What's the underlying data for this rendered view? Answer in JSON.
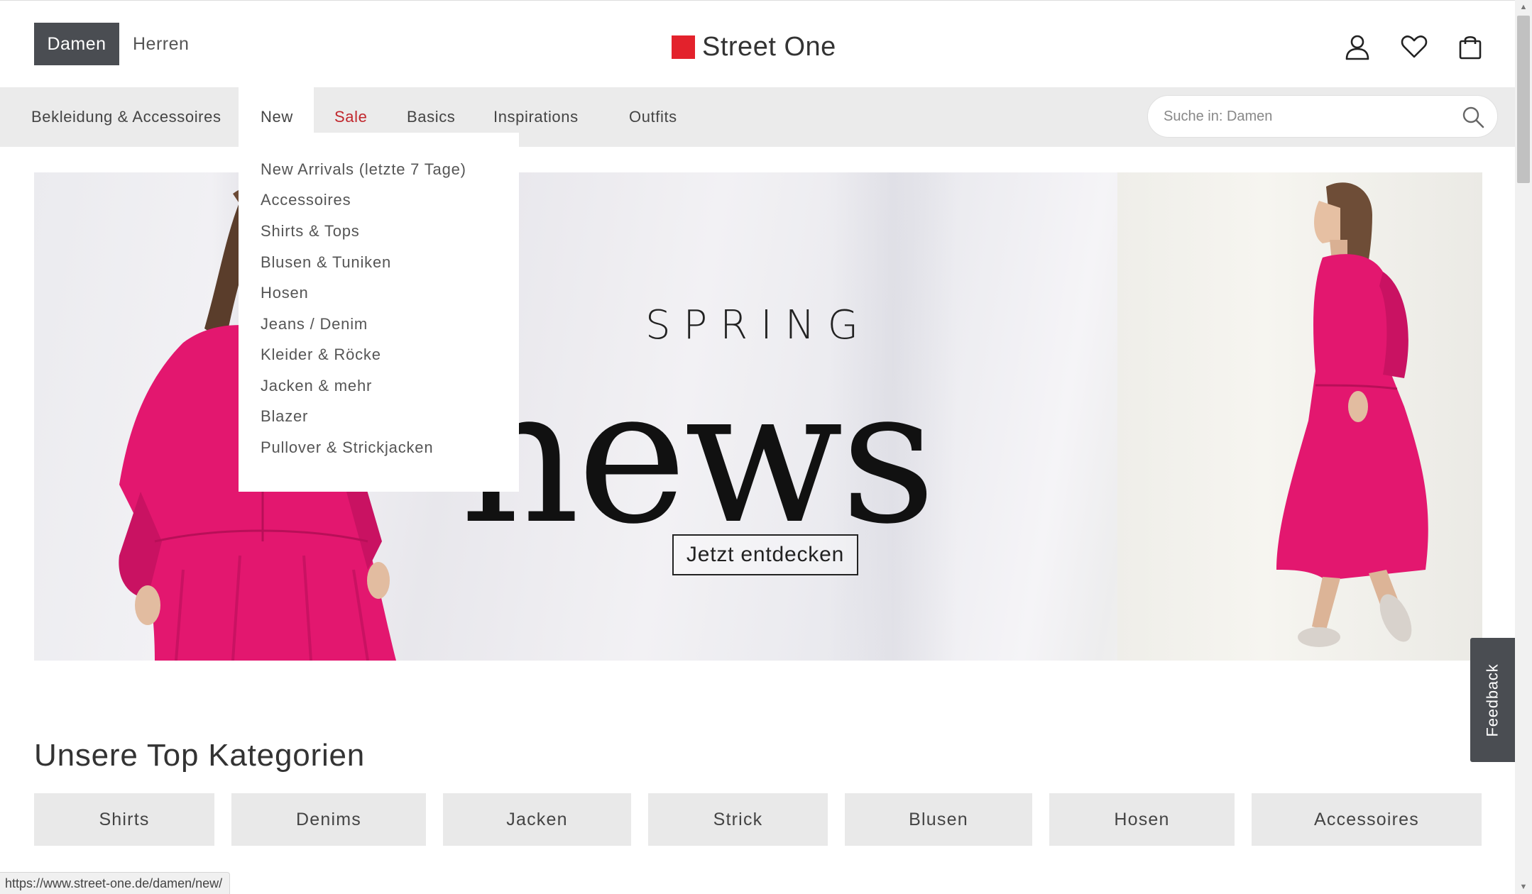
{
  "header": {
    "gender_tabs": [
      "Damen",
      "Herren"
    ],
    "brand": "Street One",
    "icons": [
      "user-icon",
      "heart-icon",
      "shopping-bag-icon"
    ]
  },
  "nav": {
    "items": [
      "Bekleidung & Accessoires",
      "New",
      "Sale",
      "Basics",
      "Inspirations",
      "Outfits"
    ],
    "active": "New",
    "search_placeholder": "Suche in: Damen"
  },
  "dropdown": {
    "items": [
      "New Arrivals (letzte 7 Tage)",
      "Accessoires",
      "Shirts & Tops",
      "Blusen & Tuniken",
      "Hosen",
      "Jeans / Denim",
      "Kleider & Röcke",
      "Jacken & mehr",
      "Blazer",
      "Pullover & Strickjacken"
    ]
  },
  "hero": {
    "headline_small": "SPRING",
    "headline_large": "news",
    "cta": "Jetzt entdecken"
  },
  "categories": {
    "title": "Unsere Top Kategorien",
    "items": [
      "Shirts",
      "Denims",
      "Jacken",
      "Strick",
      "Blusen",
      "Hosen",
      "Accessoires"
    ]
  },
  "feedback": "Feedback",
  "status_url": "https://www.street-one.de/damen/new/",
  "colors": {
    "brand_red": "#e3222c",
    "sale_red": "#c1272d",
    "dark_gray": "#4a4d52",
    "dress_pink": "#e3176f"
  }
}
